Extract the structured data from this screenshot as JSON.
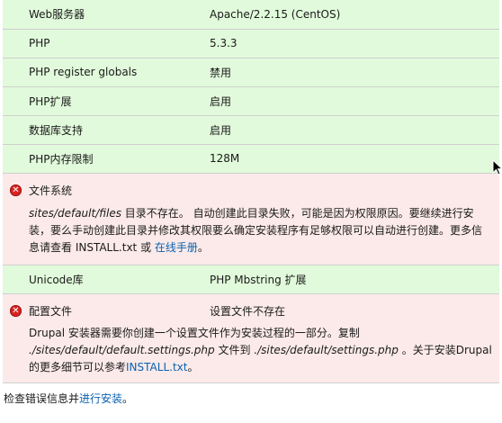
{
  "requirements": [
    {
      "label": "Web服务器",
      "value": "Apache/2.2.15 (CentOS)"
    },
    {
      "label": "PHP",
      "value": "5.3.3"
    },
    {
      "label": "PHP register globals",
      "value": "禁用"
    },
    {
      "label": "PHP扩展",
      "value": "启用"
    },
    {
      "label": "数据库支持",
      "value": "启用"
    },
    {
      "label": "PHP内存限制",
      "value": "128M"
    }
  ],
  "files_error": {
    "label": "文件系统",
    "path": "sites/default/files",
    "text1": " 目录不存在。 自动创建此目录失败，可能是因为权限原因。要继续进行安装，要么手动创建此目录并修改其权限要么确定安装程序有足够权限可以自动进行创建。更多信息请查看 INSTALL.txt 或 ",
    "link": "在线手册",
    "text2": "。"
  },
  "unicode_row": {
    "label": "Unicode库",
    "value": "PHP Mbstring 扩展"
  },
  "settings_error": {
    "label": "配置文件",
    "value": "设置文件不存在",
    "text1": "Drupal 安装器需要你创建一个设置文件作为安装过程的一部分。复制 ",
    "path1": "./sites/default/default.settings.php",
    "text2": " 文件到 ",
    "path2": "./sites/default/settings.php",
    "text3": " 。关于安装Drupal的更多细节可以参考",
    "link": "INSTALL.txt",
    "text4": "。"
  },
  "footer": {
    "text": "检查错误信息并",
    "link": "进行安装",
    "end": "。"
  },
  "colors": {
    "ok_bg": "#e1fadb",
    "error_bg": "#fbeae9",
    "link": "#0a62b0",
    "error_icon": "#d72323"
  },
  "icons": {
    "error": "error-x-icon",
    "cursor": "mouse-pointer-icon"
  }
}
